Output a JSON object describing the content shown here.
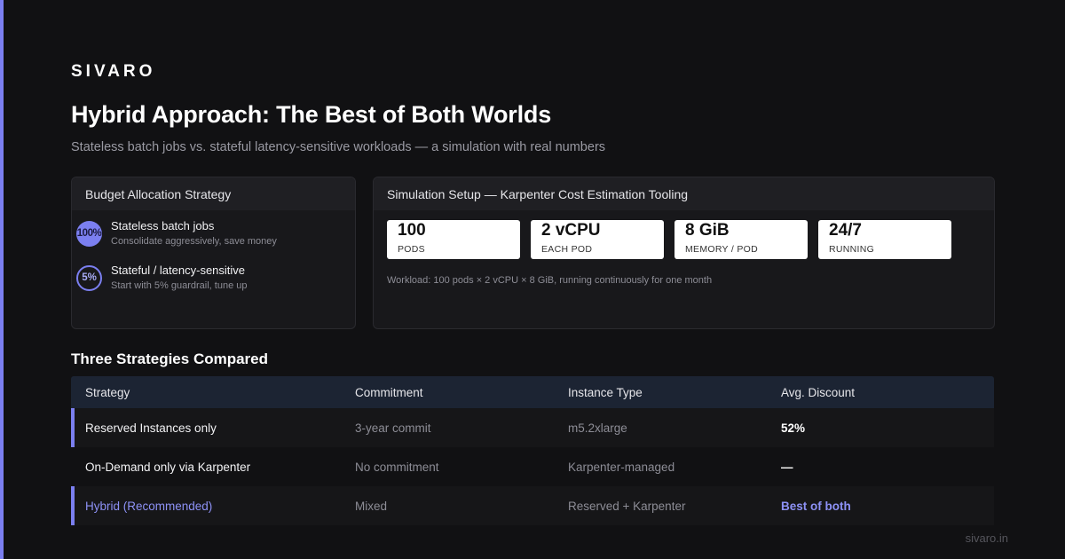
{
  "brand": "SIVARO",
  "title": "Hybrid Approach: The Best of Both Worlds",
  "subtitle": "Stateless batch jobs vs. stateful latency-sensitive workloads — a simulation with real numbers",
  "budget": {
    "heading": "Budget Allocation Strategy",
    "items": [
      {
        "badge": "100%",
        "title": "Stateless batch jobs",
        "desc": "Consolidate aggressively, save money"
      },
      {
        "badge": "5%",
        "title": "Stateful / latency-sensitive",
        "desc": "Start with 5% guardrail, tune up"
      }
    ]
  },
  "simulation": {
    "heading": "Simulation Setup — Karpenter Cost Estimation Tooling",
    "stats": [
      {
        "value": "100",
        "label": "PODS"
      },
      {
        "value": "2 vCPU",
        "label": "EACH POD"
      },
      {
        "value": "8 GiB",
        "label": "MEMORY / POD"
      },
      {
        "value": "24/7",
        "label": "RUNNING"
      }
    ],
    "workload": "Workload: 100 pods × 2 vCPU × 8 GiB, running continuously for one month"
  },
  "comparison": {
    "heading": "Three Strategies Compared",
    "columns": [
      "Strategy",
      "Commitment",
      "Instance Type",
      "Avg. Discount"
    ],
    "rows": [
      [
        "Reserved Instances only",
        "3-year commit",
        "m5.2xlarge",
        "52%"
      ],
      [
        "On-Demand only via Karpenter",
        "No commitment",
        "Karpenter-managed",
        "—"
      ],
      [
        "Hybrid (Recommended)",
        "Mixed",
        "Reserved + Karpenter",
        "Best of both"
      ]
    ]
  },
  "footer": "sivaro.in",
  "colors": {
    "accent": "#7b7ff0",
    "background": "#111113",
    "panel": "#18181b",
    "table_header": "#1c2433"
  }
}
